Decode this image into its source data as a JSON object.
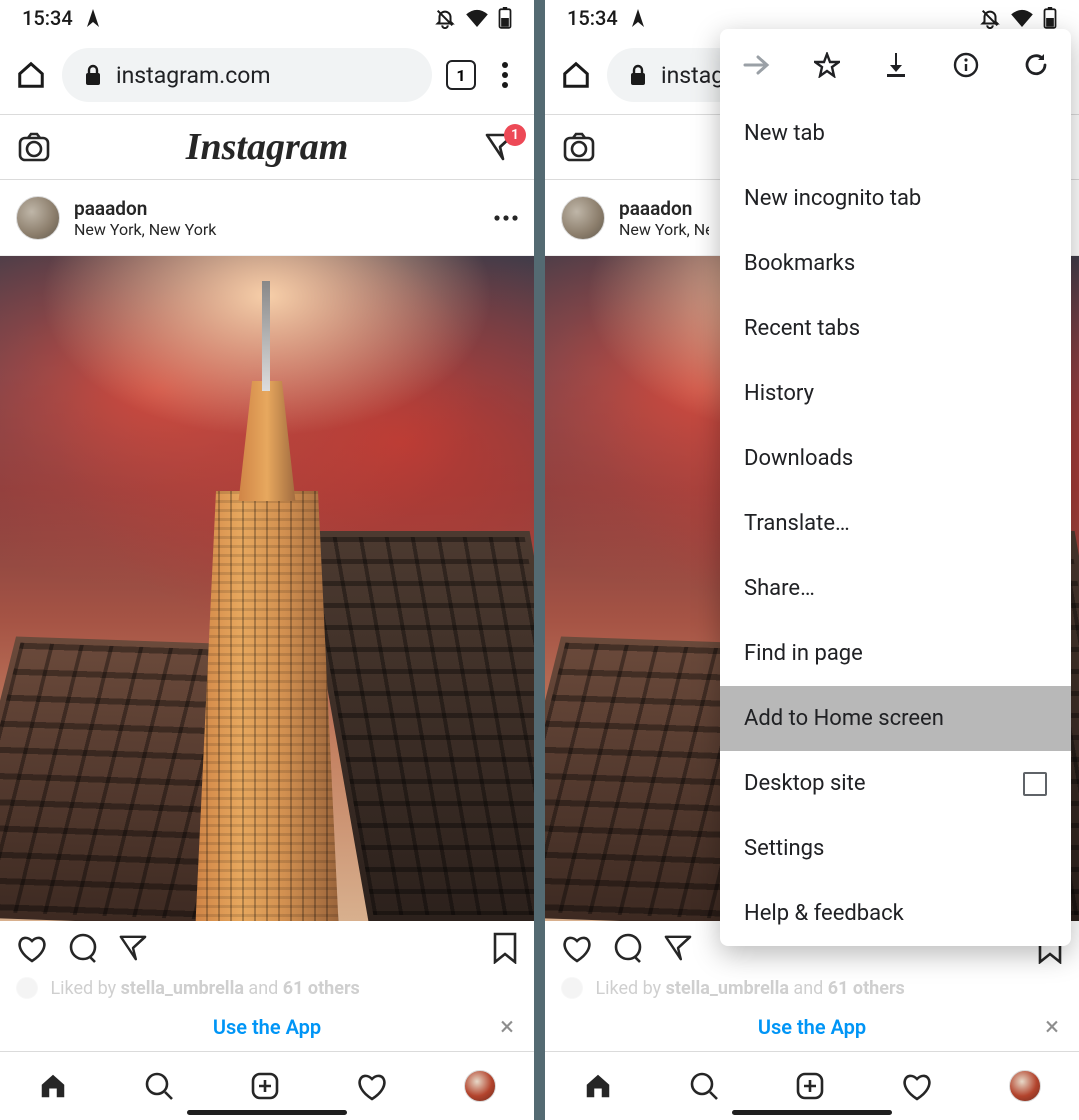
{
  "status": {
    "time": "15:34"
  },
  "chrome": {
    "url": "instagram.com",
    "url_truncated": "instag",
    "tab_count": "1"
  },
  "ig": {
    "logo": "Instagram",
    "dm_badge": "1"
  },
  "post": {
    "username": "paaadon",
    "location": "New York, New York",
    "likes_prefix": "Liked by ",
    "likes_user": "stella_umbrella",
    "likes_mid": " and ",
    "likes_count": "61 others"
  },
  "prompt": {
    "text": "Use the App",
    "close": "×"
  },
  "menu": {
    "items": [
      "New tab",
      "New incognito tab",
      "Bookmarks",
      "Recent tabs",
      "History",
      "Downloads",
      "Translate…",
      "Share…",
      "Find in page",
      "Add to Home screen",
      "Desktop site",
      "Settings",
      "Help & feedback"
    ],
    "highlighted_index": 9,
    "checkbox_index": 10
  }
}
